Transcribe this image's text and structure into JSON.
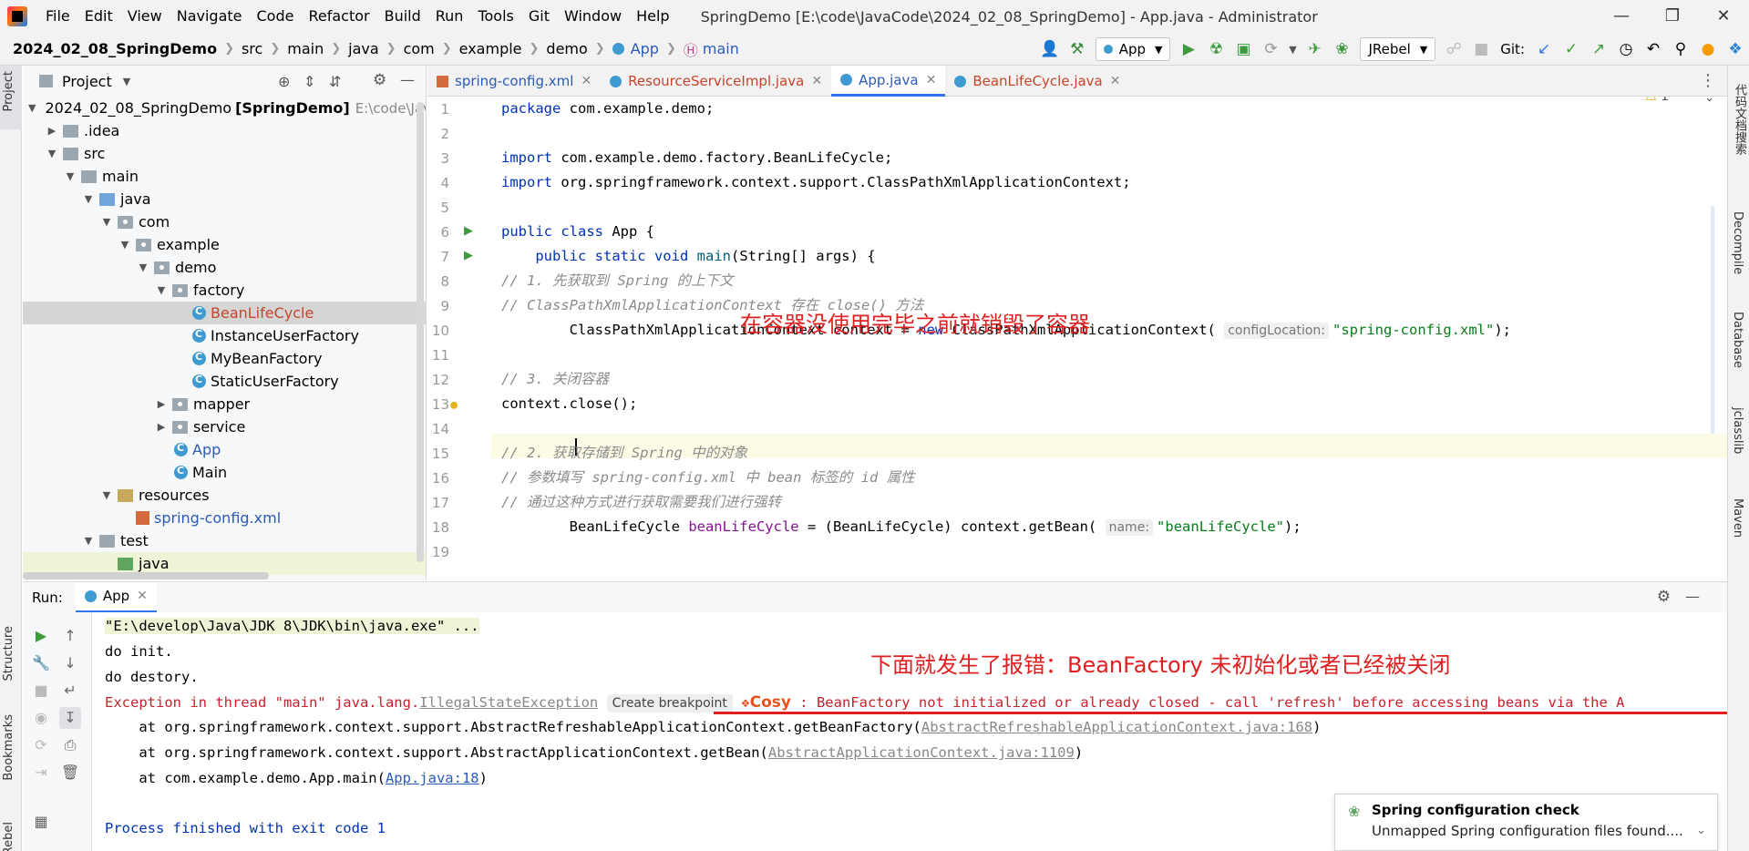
{
  "menu": [
    "File",
    "Edit",
    "View",
    "Navigate",
    "Code",
    "Refactor",
    "Build",
    "Run",
    "Tools",
    "Git",
    "Window",
    "Help"
  ],
  "window_title": "SpringDemo [E:\\code\\JavaCode\\2024_02_08_SpringDemo] - App.java - Administrator",
  "breadcrumb": [
    "2024_02_08_SpringDemo",
    "src",
    "main",
    "java",
    "com",
    "example",
    "demo",
    "App",
    "main"
  ],
  "toolbar": {
    "run_config": "App",
    "jrebel": "JRebel",
    "git_label": "Git:"
  },
  "project_panel": {
    "title": "Project",
    "rows": [
      {
        "label": "2024_02_08_SpringDemo",
        "suffix": "[SpringDemo]",
        "path": "E:\\code\\Java"
      },
      {
        "label": ".idea"
      },
      {
        "label": "src"
      },
      {
        "label": "main"
      },
      {
        "label": "java"
      },
      {
        "label": "com"
      },
      {
        "label": "example"
      },
      {
        "label": "demo"
      },
      {
        "label": "factory"
      },
      {
        "label": "BeanLifeCycle"
      },
      {
        "label": "InstanceUserFactory"
      },
      {
        "label": "MyBeanFactory"
      },
      {
        "label": "StaticUserFactory"
      },
      {
        "label": "mapper"
      },
      {
        "label": "service"
      },
      {
        "label": "App"
      },
      {
        "label": "Main"
      },
      {
        "label": "resources"
      },
      {
        "label": "spring-config.xml"
      },
      {
        "label": "test"
      },
      {
        "label": "java"
      }
    ]
  },
  "editor_tabs": [
    "spring-config.xml",
    "ResourceServiceImpl.java",
    "App.java",
    "BeanLifeCycle.java"
  ],
  "editor": {
    "warning_count": "1",
    "line_numbers": [
      "1",
      "2",
      "3",
      "4",
      "5",
      "6",
      "7",
      "8",
      "9",
      "10",
      "11",
      "12",
      "13",
      "14",
      "15",
      "16",
      "17",
      "18",
      "19"
    ],
    "lines": {
      "l1_kw": "package",
      "l1_rest": " com.example.demo;",
      "l3_kw": "import",
      "l3_rest": " com.example.demo.factory.BeanLifeCycle;",
      "l4_kw": "import",
      "l4_rest": " org.springframework.context.support.ClassPathXmlApplicationContext;",
      "l6_kw": "public class",
      "l6_rest": " App {",
      "l7_kw": "public static void",
      "l7_fn": "main",
      "l7_rest": "(String[] args) {",
      "l8": "// 1. 先获取到 Spring 的上下文",
      "l9": "// ClassPathXmlApplicationContext 存在 close() 方法",
      "l10_a": "ClassPathXmlApplicationContext context = ",
      "l10_kw": "new",
      "l10_b": " ClassPathXmlApplicationContext(",
      "l10_hint": "configLocation:",
      "l10_str": "\"spring-config.xml\"",
      "l10_c": ");",
      "l12": "// 3. 关闭容器",
      "l13": "context.close();",
      "l15": "// 2. 获取存储到 Spring 中的对象",
      "l16": "// 参数填写 spring-config.xml 中 bean 标签的 id 属性",
      "l17": "// 通过这种方式进行获取需要我们进行强转",
      "l18_a": "BeanLifeCycle ",
      "l18_var": "beanLifeCycle",
      "l18_b": " = (BeanLifeCycle) context.getBean(",
      "l18_hint": "name:",
      "l18_str": "\"beanLifeCycle\"",
      "l18_c": ");"
    },
    "annotation": "在容器没使用完毕之前就销毁了容器"
  },
  "run_panel": {
    "label": "Run:",
    "tab": "App",
    "annotation": "下面就发生了报错：BeanFactory 未初始化或者已经被关闭",
    "console": {
      "cmd": "\"E:\\develop\\Java\\JDK 8\\JDK\\bin\\java.exe\" ...",
      "init": "do init.",
      "destroy": "do destory.",
      "exc_prefix": "Exception in thread \"main\" java.lang.",
      "exc_class": "IllegalStateException",
      "create_bp": "Create breakpoint",
      "cosy": "Cosy",
      "exc_colon": " : ",
      "exc_msg": "BeanFactory not initialized or already closed - call 'refresh' before accessing beans via the A",
      "st1_a": "    at org.springframework.context.support.AbstractRefreshableApplicationContext.getBeanFactory(",
      "st1_link": "AbstractRefreshableApplicationContext.java:168",
      "st1_b": ")",
      "st2_a": "    at org.springframework.context.support.AbstractApplicationContext.getBean(",
      "st2_link": "AbstractApplicationContext.java:1109",
      "st2_b": ")",
      "st3_a": "    at com.example.demo.App.main(",
      "st3_link": "App.java:18",
      "st3_b": ")",
      "exit": "Process finished with exit code 1"
    }
  },
  "notification": {
    "title": "Spring configuration check",
    "body": "Unmapped Spring configuration files found...."
  },
  "left_stripe": [
    "Project",
    "Structure",
    "Bookmarks",
    "Rebel"
  ],
  "right_stripe": [
    "代码文档搜索",
    "Decompile",
    "Database",
    "jclasslib",
    "Maven"
  ],
  "colors": {
    "accent": "#3574f0",
    "annotation": "#e02020",
    "keyword": "#0033b3",
    "string": "#067d17",
    "error": "#c7222d"
  }
}
